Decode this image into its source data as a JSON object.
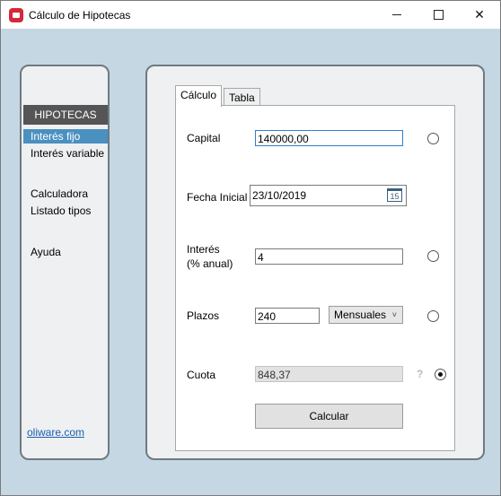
{
  "window": {
    "title": "Cálculo de Hipotecas",
    "icon": "mortgage-app-icon"
  },
  "sidebar": {
    "header": "HIPOTECAS",
    "items": [
      {
        "label": "Interés fijo",
        "active": true
      },
      {
        "label": "Interés variable",
        "active": false
      },
      {
        "label": "Calculadora",
        "active": false
      },
      {
        "label": "Listado tipos",
        "active": false
      },
      {
        "label": "Ayuda",
        "active": false
      }
    ],
    "link": "oliware.com"
  },
  "tabs": [
    {
      "label": "Cálculo",
      "selected": true
    },
    {
      "label": "Tabla",
      "selected": false
    }
  ],
  "form": {
    "capital": {
      "label": "Capital",
      "value": "140000,00"
    },
    "fecha": {
      "label": "Fecha Inicial",
      "value": "23/10/2019",
      "calendar_day": "15"
    },
    "interes": {
      "label_line1": "Interés",
      "label_line2": "(% anual)",
      "value": "4"
    },
    "plazos": {
      "label": "Plazos",
      "value": "240",
      "period": "Mensuales"
    },
    "cuota": {
      "label": "Cuota",
      "value": "848,37",
      "help": "?"
    },
    "calcular": "Calcular"
  },
  "colors": {
    "accent": "#4a90c0",
    "background": "#c5d7e2",
    "sidebar_header": "#555555",
    "link": "#1a5fb0"
  }
}
